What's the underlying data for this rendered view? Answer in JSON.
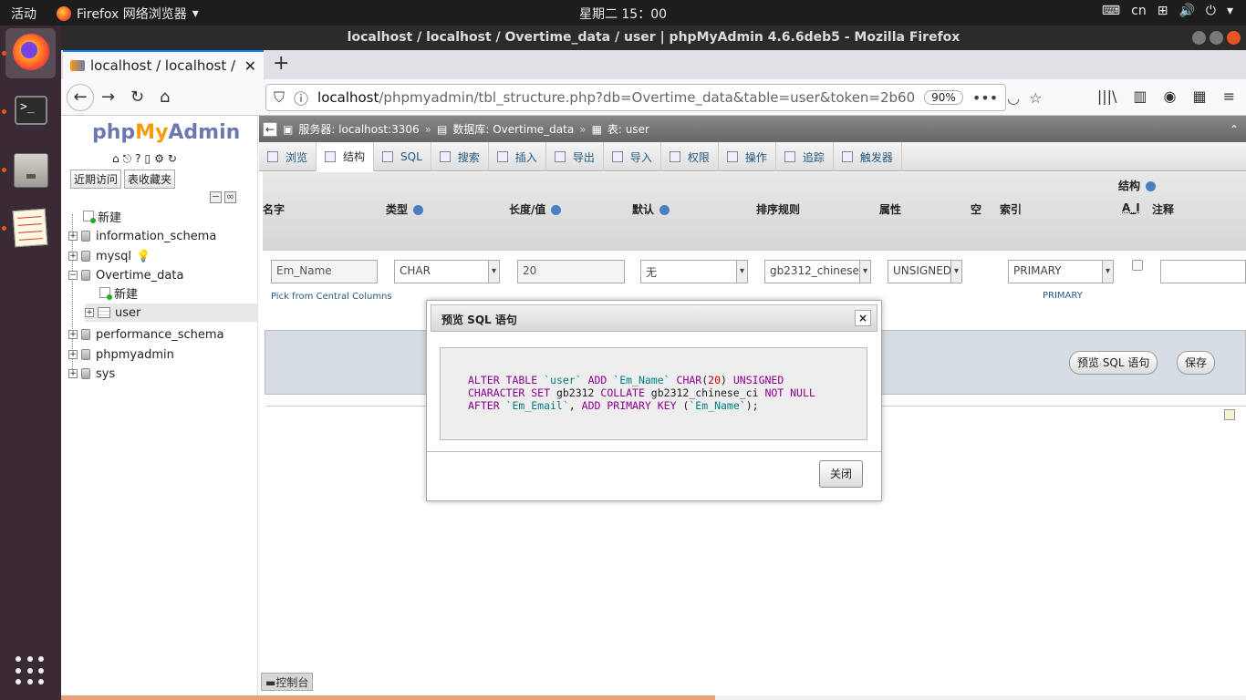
{
  "system_bar": {
    "activities": "活动",
    "app_name": "Firefox 网络浏览器",
    "clock": "星期二 15：00",
    "input_method": "cn"
  },
  "window": {
    "title": "localhost / localhost / Overtime_data / user | phpMyAdmin 4.6.6deb5 - Mozilla Firefox"
  },
  "browser": {
    "tab_title": "localhost / localhost / Ov",
    "url_host": "localhost",
    "url_path": "/phpmyadmin/tbl_structure.php?db=Overtime_data&table=user&token=2b60",
    "zoom": "90%"
  },
  "pma_nav": {
    "logo_php": "php",
    "logo_my": "My",
    "logo_admin": "Admin",
    "recent_tab": "近期访问",
    "favorites_tab": "表收藏夹",
    "tree": [
      {
        "label": "新建"
      },
      {
        "label": "information_schema"
      },
      {
        "label": "mysql"
      },
      {
        "label": "Overtime_data"
      },
      {
        "label": "新建"
      },
      {
        "label": "user"
      },
      {
        "label": "performance_schema"
      },
      {
        "label": "phpmyadmin"
      },
      {
        "label": "sys"
      }
    ]
  },
  "breadcrumb": {
    "server": "服务器: localhost:3306",
    "database": "数据库: Overtime_data",
    "table": "表: user"
  },
  "topmenu": [
    {
      "label": "浏览"
    },
    {
      "label": "结构"
    },
    {
      "label": "SQL"
    },
    {
      "label": "搜索"
    },
    {
      "label": "插入"
    },
    {
      "label": "导出"
    },
    {
      "label": "导入"
    },
    {
      "label": "权限"
    },
    {
      "label": "操作"
    },
    {
      "label": "追踪"
    },
    {
      "label": "触发器"
    }
  ],
  "structure": {
    "section_label": "结构",
    "headers": {
      "name": "名字",
      "type": "类型",
      "length": "长度/值",
      "default": "默认",
      "collation": "排序规则",
      "attributes": "属性",
      "null": "空",
      "index": "索引",
      "ai": "A_I",
      "comment": "注释"
    },
    "row": {
      "name_placeholder": "Em_Name",
      "type": "CHAR",
      "length": "20",
      "default": "无",
      "collation": "gb2312_chinese_ci",
      "attributes": "UNSIGNED",
      "index": "PRIMARY",
      "index_note": "PRIMARY",
      "central_columns_link": "Pick from Central Columns"
    },
    "preview_sql_button": "预览 SQL 语句",
    "save_button": "保存",
    "console_label": "控制台"
  },
  "modal": {
    "title": "预览 SQL 语句",
    "close_x": "×",
    "close_button": "关闭",
    "sql_line1_parts": [
      "ALTER TABLE",
      " `user` ",
      "ADD",
      " `Em_Name` ",
      "CHAR",
      "(",
      "20",
      ") ",
      "UNSIGNED"
    ],
    "sql_line2_parts": [
      "CHARACTER SET",
      " gb2312 ",
      "COLLATE",
      " gb2312_chinese_ci ",
      "NOT NULL"
    ],
    "sql_line3_parts": [
      "AFTER",
      " `Em_Email`",
      ", ",
      "ADD PRIMARY KEY",
      " (",
      "`Em_Name`",
      ");"
    ]
  },
  "colors": {
    "accent": "#e95420",
    "pma_link": "#235a81",
    "sql_keyword": "#900090",
    "sql_string": "#008080"
  }
}
